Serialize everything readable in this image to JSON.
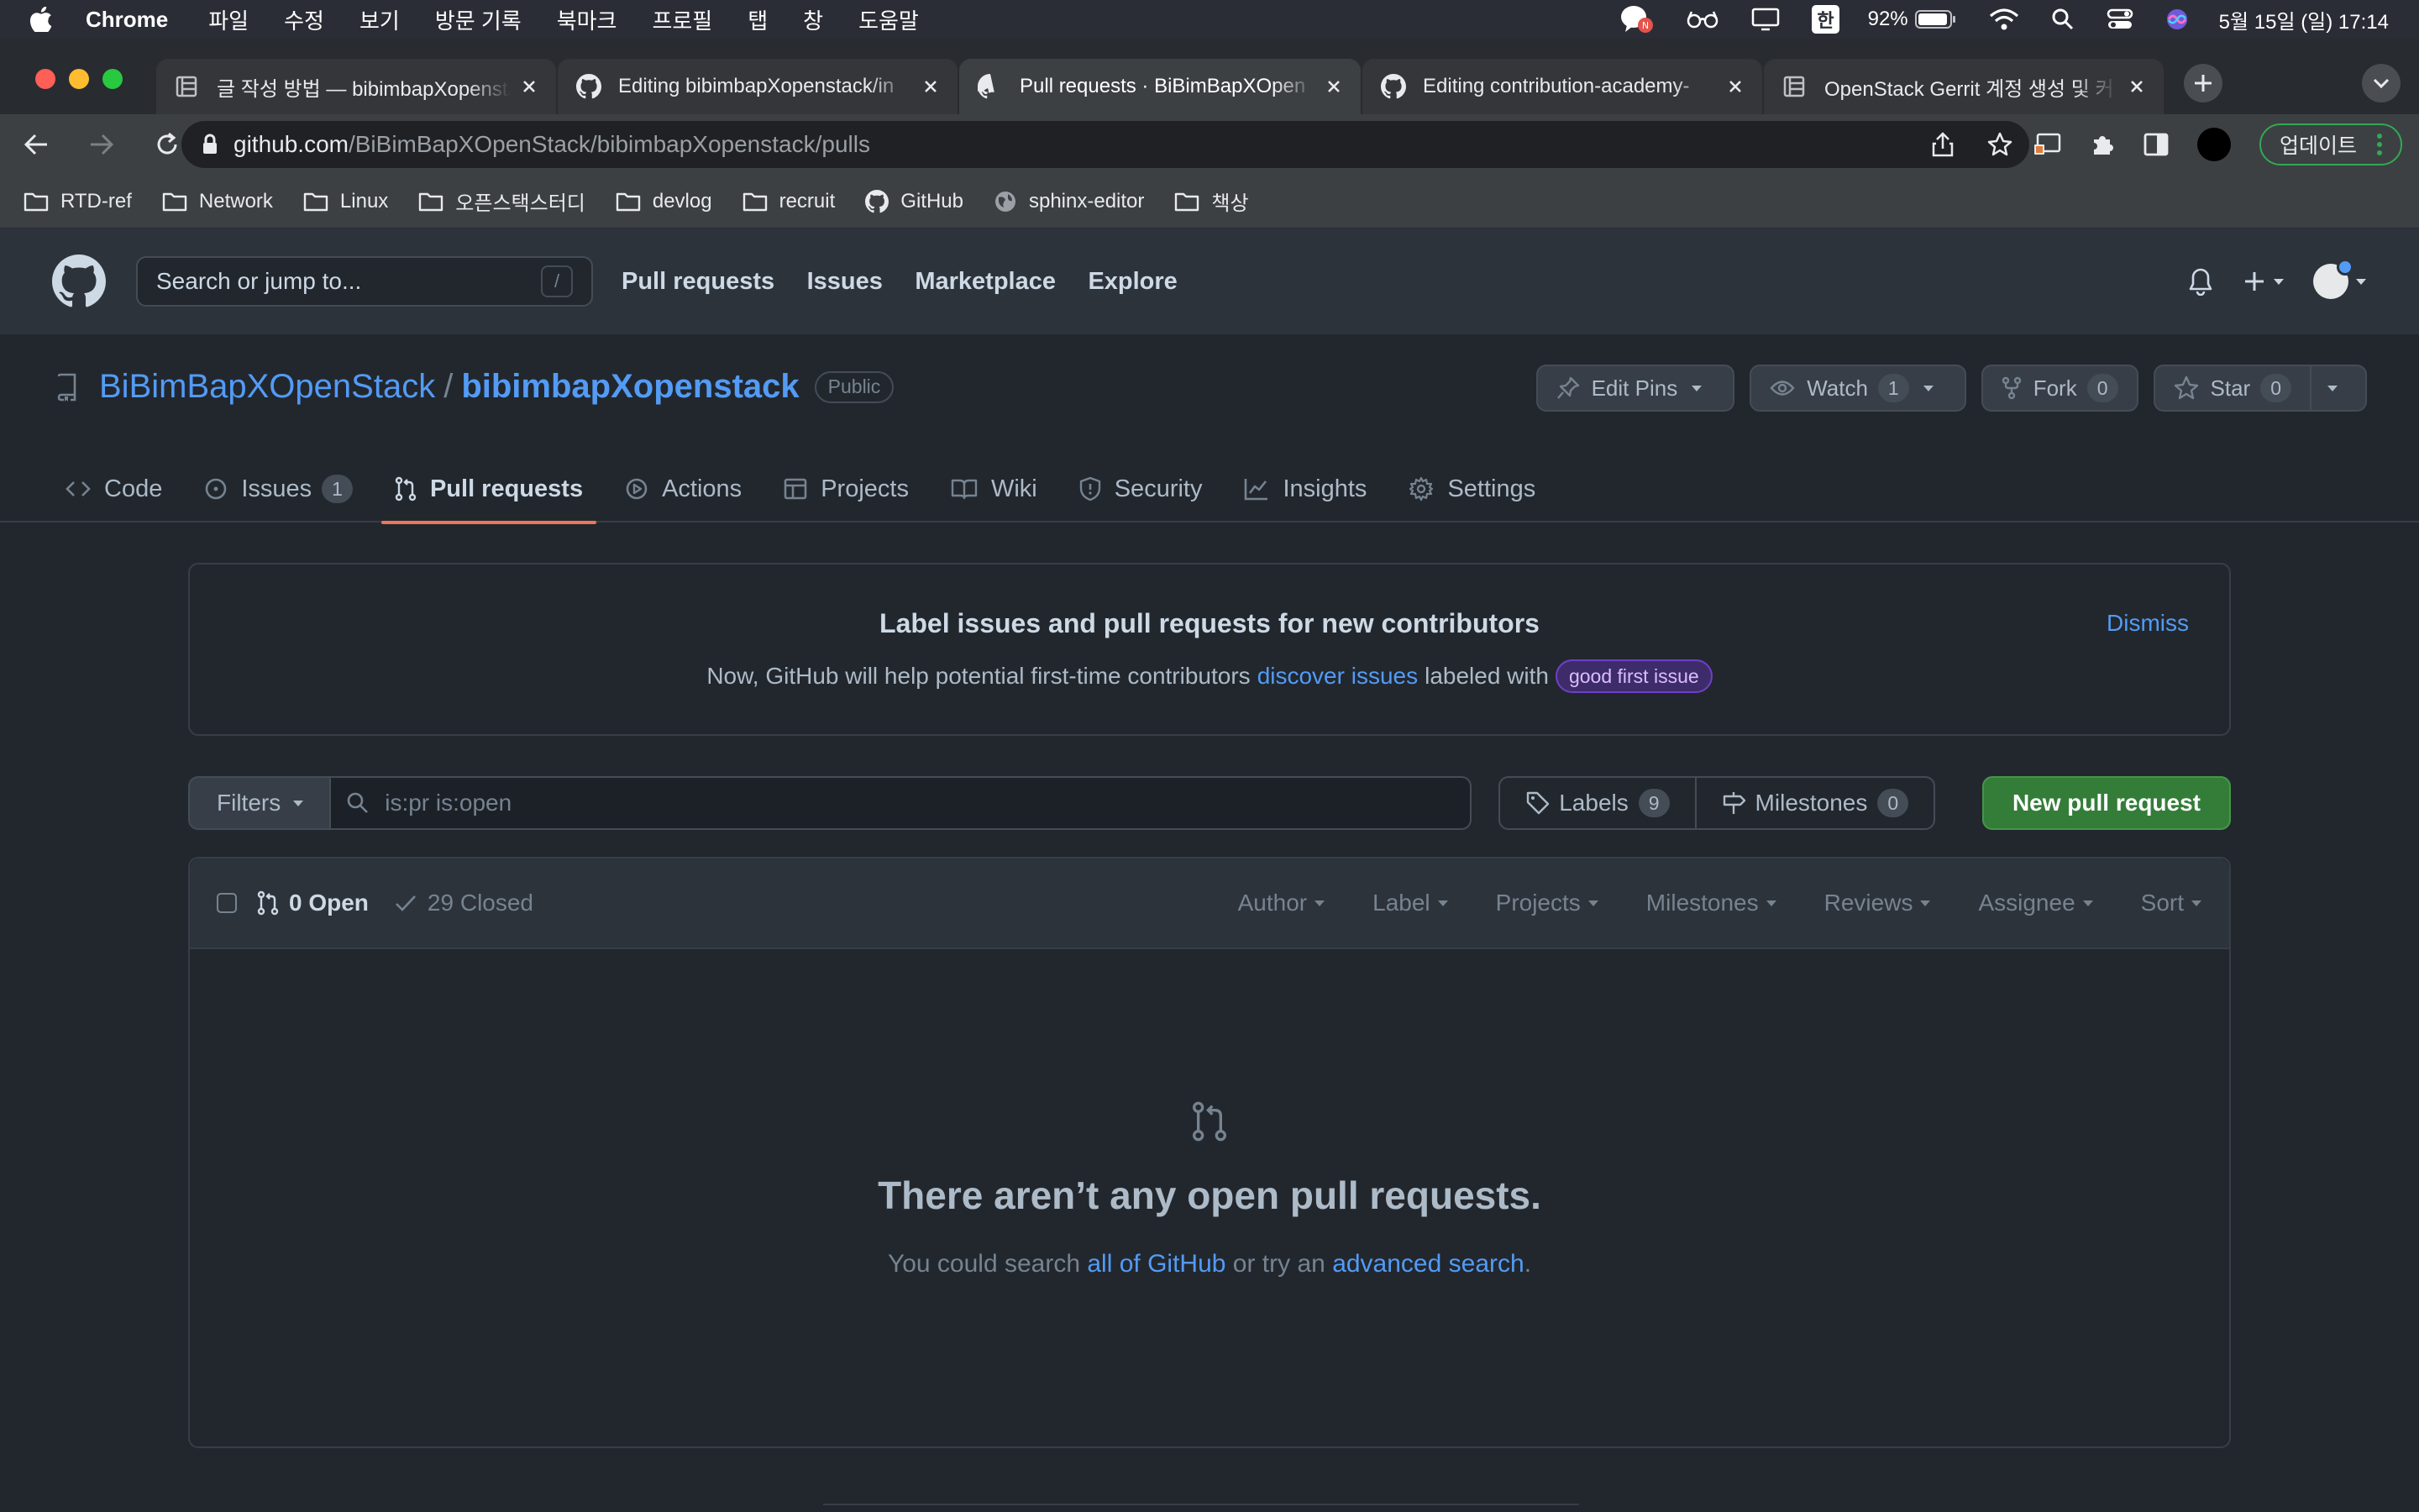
{
  "menubar": {
    "app_name": "Chrome",
    "menus": [
      "파일",
      "수정",
      "보기",
      "방문 기록",
      "북마크",
      "프로필",
      "탭",
      "창",
      "도움말"
    ],
    "battery_pct": "92%",
    "clock": "5월 15일 (일)  17:14",
    "input_source": "한"
  },
  "browser": {
    "tabs": [
      {
        "title": "글 작성 방법 — bibimbapXopenstack",
        "icon": "doc-icon"
      },
      {
        "title": "Editing bibimbapXopenstack/in",
        "icon": "github-icon"
      },
      {
        "title": "Pull requests · BiBimBapXOpen",
        "icon": "github-icon"
      },
      {
        "title": "Editing contribution-academy-",
        "icon": "github-icon"
      },
      {
        "title": "OpenStack Gerrit 계정 생성 및 커",
        "icon": "doc-icon"
      }
    ],
    "url_host": "github.com",
    "url_path": "/BiBimBapXOpenStack/bibimbapXopenstack/pulls",
    "update_label": "업데이트",
    "bookmarks": [
      {
        "label": "RTD-ref",
        "icon": "folder-icon"
      },
      {
        "label": "Network",
        "icon": "folder-icon"
      },
      {
        "label": "Linux",
        "icon": "folder-icon"
      },
      {
        "label": "오픈스택스터디",
        "icon": "folder-icon"
      },
      {
        "label": "devlog",
        "icon": "folder-icon"
      },
      {
        "label": "recruit",
        "icon": "folder-icon"
      },
      {
        "label": "GitHub",
        "icon": "github-icon"
      },
      {
        "label": "sphinx-editor",
        "icon": "globe-icon"
      },
      {
        "label": "책상",
        "icon": "folder-icon"
      }
    ]
  },
  "github": {
    "search_placeholder": "Search or jump to...",
    "search_shortcut": "/",
    "nav": [
      "Pull requests",
      "Issues",
      "Marketplace",
      "Explore"
    ]
  },
  "repo": {
    "owner": "BiBimBapXOpenStack",
    "separator": "/",
    "name": "bibimbapXopenstack",
    "visibility": "Public",
    "edit_pins": "Edit Pins",
    "watch": "Watch",
    "watch_count": "1",
    "fork": "Fork",
    "fork_count": "0",
    "star": "Star",
    "star_count": "0",
    "tabs": {
      "code": "Code",
      "issues": "Issues",
      "issues_count": "1",
      "pulls": "Pull requests",
      "actions": "Actions",
      "projects": "Projects",
      "wiki": "Wiki",
      "security": "Security",
      "insights": "Insights",
      "settings": "Settings"
    }
  },
  "banner": {
    "title": "Label issues and pull requests for new contributors",
    "text_before": "Now, GitHub will help potential first-time contributors",
    "link": "discover issues",
    "text_after": "labeled with",
    "label": "good first issue",
    "dismiss": "Dismiss"
  },
  "filters": {
    "filters_label": "Filters",
    "query": "is:pr is:open",
    "labels": "Labels",
    "labels_count": "9",
    "milestones": "Milestones",
    "milestones_count": "0",
    "new_pr": "New pull request"
  },
  "pr_list": {
    "open": "0 Open",
    "closed": "29 Closed",
    "filters": [
      "Author",
      "Label",
      "Projects",
      "Milestones",
      "Reviews",
      "Assignee",
      "Sort"
    ],
    "empty_title": "There aren’t any open pull requests.",
    "empty_before": "You could search",
    "empty_link1": "all of GitHub",
    "empty_middle": "or try an",
    "empty_link2": "advanced search",
    "empty_after": "."
  }
}
